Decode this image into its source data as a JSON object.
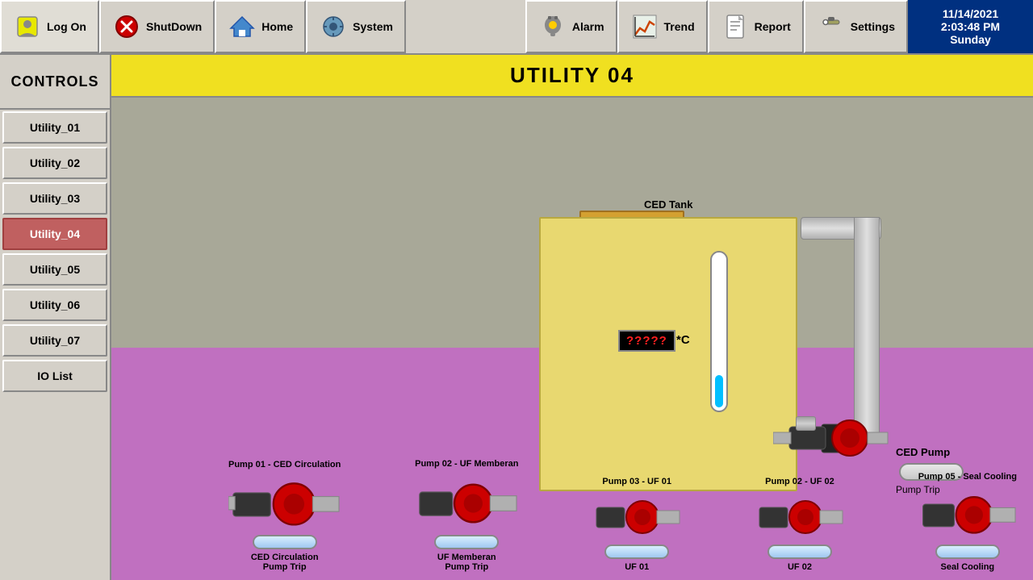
{
  "toolbar": {
    "logon_label": "Log On",
    "shutdown_label": "ShutDown",
    "home_label": "Home",
    "system_label": "System",
    "alarm_label": "Alarm",
    "trend_label": "Trend",
    "report_label": "Report",
    "settings_label": "Settings",
    "datetime": {
      "date": "11/14/2021",
      "time": "2:03:48 PM",
      "day": "Sunday"
    }
  },
  "sidebar": {
    "header": "CONTROLS",
    "items": [
      {
        "id": "utility_01",
        "label": "Utility_01",
        "active": false
      },
      {
        "id": "utility_02",
        "label": "Utility_02",
        "active": false
      },
      {
        "id": "utility_03",
        "label": "Utility_03",
        "active": false
      },
      {
        "id": "utility_04",
        "label": "Utility_04",
        "active": true
      },
      {
        "id": "utility_05",
        "label": "Utility_05",
        "active": false
      },
      {
        "id": "utility_06",
        "label": "Utility_06",
        "active": false
      },
      {
        "id": "utility_07",
        "label": "Utility_07",
        "active": false
      },
      {
        "id": "io_list",
        "label": "IO  List",
        "active": false
      }
    ]
  },
  "page": {
    "title": "UTILITY 04"
  },
  "scene": {
    "ced_tank_label": "CED Tank",
    "temp_value": "?????",
    "temp_unit": "*C",
    "ced_pump_label": "CED Pump",
    "pump_trip_label": "Pump Trip"
  },
  "bottom_pumps": [
    {
      "id": "pump01",
      "title": "Pump 01 - CED Circulation",
      "trip_label": "CED Circulation\nPump Trip"
    },
    {
      "id": "pump02",
      "title": "Pump 02 - UF Memberan",
      "trip_label": "UF Memberan\nPump Trip"
    },
    {
      "id": "pump03",
      "title": "Pump 03 - UF 01",
      "trip_label": "UF 01"
    },
    {
      "id": "pump04",
      "title": "Pump 02 - UF 02",
      "trip_label": "UF 02"
    },
    {
      "id": "pump05",
      "title": "Pump 05 - Seal Cooling",
      "trip_label": "Seal Cooling"
    }
  ]
}
